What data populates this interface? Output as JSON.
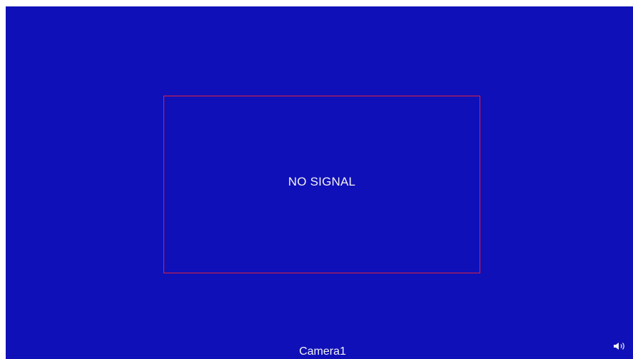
{
  "screen": {
    "background_color": "#1010b8",
    "message": "NO SIGNAL",
    "message_border_color": "#e0203a",
    "camera_name": "Camera1",
    "audio_icon": "speaker-volume-icon"
  }
}
